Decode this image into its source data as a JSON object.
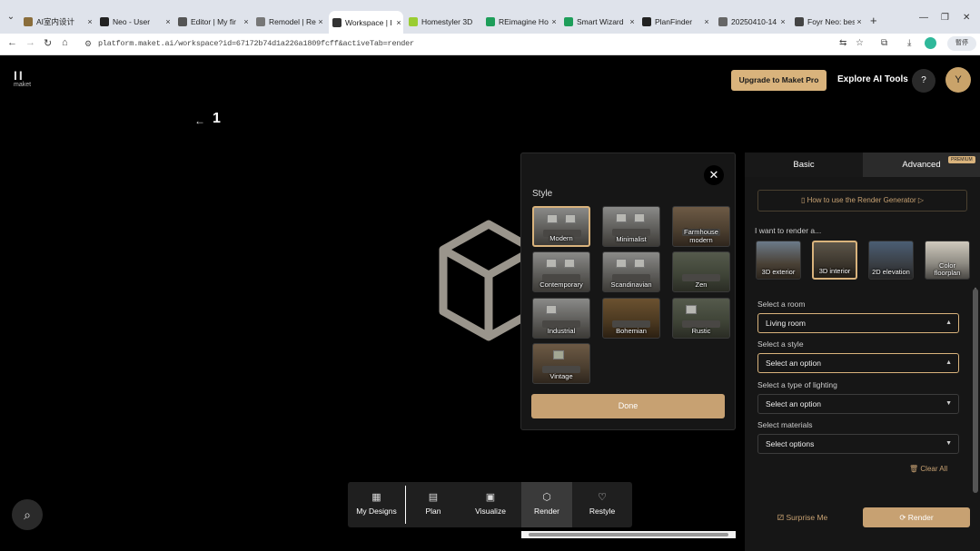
{
  "browser": {
    "tabs": [
      {
        "label": "AI室内设计",
        "fav": "#8a6d3b"
      },
      {
        "label": "Neo - User",
        "fav": "#222"
      },
      {
        "label": "Editor | My fir",
        "fav": "#555"
      },
      {
        "label": "Remodel | Re",
        "fav": "#777"
      },
      {
        "label": "Workspace | I",
        "fav": "#333"
      },
      {
        "label": "Homestyler 3D",
        "fav": "#9acd32"
      },
      {
        "label": "REimagine Ho",
        "fav": "#1e9e5a"
      },
      {
        "label": "Smart Wizard",
        "fav": "#1e9e5a"
      },
      {
        "label": "PlanFinder",
        "fav": "#222"
      },
      {
        "label": "20250410-14",
        "fav": "#666"
      },
      {
        "label": "Foyr Neo: bes",
        "fav": "#444"
      }
    ],
    "close_glyph": "×",
    "new_tab": "+",
    "url": "platform.maket.ai/workspace?id=67172b74d1a226a1809fcff&activeTab=render",
    "profile": "暫停"
  },
  "app": {
    "logo_bars": "II",
    "logo_word": "maket",
    "upgrade_label": "Upgrade to Maket Pro",
    "explore_label": "Explore AI Tools",
    "help_label": "?",
    "avatar_initial": "Y",
    "back_arrow": "←",
    "page_number": "1"
  },
  "style_modal": {
    "close_glyph": "✕",
    "heading": "Style",
    "options": [
      {
        "label": "Modern"
      },
      {
        "label": "Minimalist"
      },
      {
        "label": "Farmhouse modern"
      },
      {
        "label": "Contemporary"
      },
      {
        "label": "Scandinavian"
      },
      {
        "label": "Zen"
      },
      {
        "label": "Industrial"
      },
      {
        "label": "Bohemian"
      },
      {
        "label": "Rustic"
      },
      {
        "label": "Vintage"
      }
    ],
    "done_label": "Done"
  },
  "panel": {
    "tab_basic": "Basic",
    "tab_advanced": "Advanced",
    "premium_badge": "PREMIUM",
    "howto_label": "How to use the Render Generator ▷",
    "render_heading": "I want to render a...",
    "render_types": [
      {
        "label": "3D exterior"
      },
      {
        "label": "3D interior"
      },
      {
        "label": "2D elevation"
      },
      {
        "label": "Color floorplan"
      }
    ],
    "room_label": "Select a room",
    "room_value": "Living room",
    "style_label": "Select a style",
    "style_value": "Select an option",
    "lighting_label": "Select a type of lighting",
    "lighting_value": "Select an option",
    "materials_label": "Select materials",
    "materials_value": "Select options",
    "clear_label": "Clear All",
    "surprise_label": "Surprise Me",
    "render_label": "Render"
  },
  "toolbar": {
    "items": [
      {
        "label": "My Designs",
        "icon": "grid-icon"
      },
      {
        "label": "Plan",
        "icon": "plan-icon"
      },
      {
        "label": "Visualize",
        "icon": "visualize-icon"
      },
      {
        "label": "Render",
        "icon": "cube-icon"
      },
      {
        "label": "Restyle",
        "icon": "restyle-icon"
      }
    ]
  },
  "colors": {
    "accent": "#d9b37c",
    "button": "#c7a172",
    "panel": "#161616"
  }
}
